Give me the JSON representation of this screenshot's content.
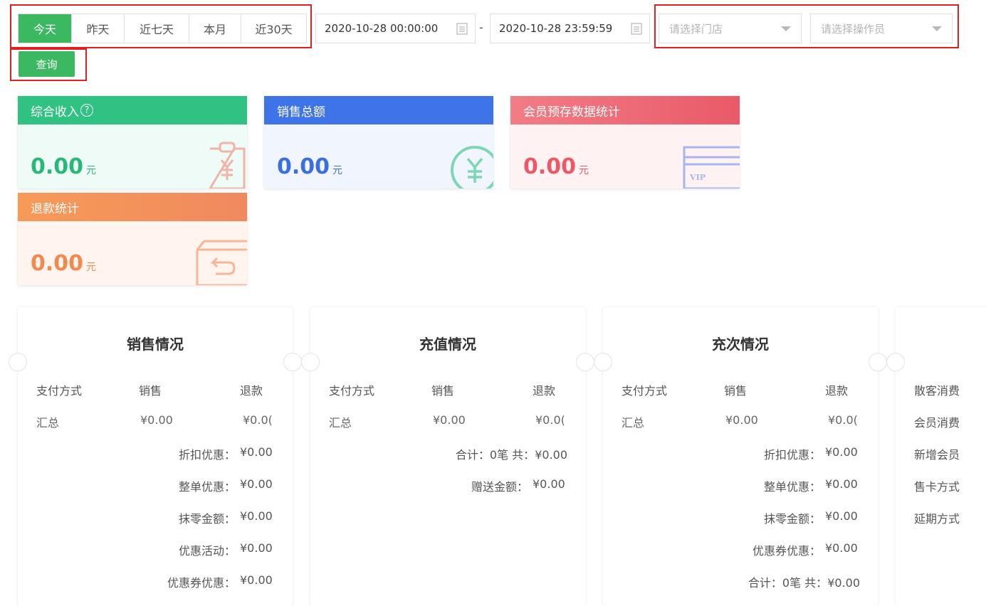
{
  "filters": {
    "ranges": [
      "今天",
      "昨天",
      "近七天",
      "本月",
      "近30天"
    ],
    "active_range": "今天",
    "start_date": "2020-10-28 00:00:00",
    "end_date": "2020-10-28 23:59:59",
    "date_sep": "-",
    "store_placeholder": "请选择门店",
    "operator_placeholder": "请选择操作员",
    "query_label": "查询"
  },
  "cards": [
    {
      "title": "综合收入",
      "help": "?",
      "value": "0.00",
      "unit": "元",
      "icon": "clipboard-yuan-icon",
      "head_color": "#30c283",
      "body_color": "#effbf6",
      "value_color": "#2ab87a"
    },
    {
      "title": "销售总额",
      "value": "0.00",
      "unit": "元",
      "icon": "yuan-circle-icon",
      "head_color": "#3f73e8",
      "body_color": "#f1f5fd",
      "value_color": "#3b6fe0"
    },
    {
      "title": "会员预存数据统计",
      "value": "0.00",
      "unit": "元",
      "icon": "vip-card-icon",
      "icon_text": "VIP",
      "head_color": "#ee6470",
      "body_color": "#fef2f3",
      "value_color": "#ec5866"
    },
    {
      "title": "退款统计",
      "value": "0.00",
      "unit": "元",
      "icon": "return-box-icon",
      "head_color": "#f5905a",
      "body_color": "#fff4ee",
      "value_color": "#f28a4f"
    }
  ],
  "panels": [
    {
      "title": "销售情况",
      "headers": [
        "支付方式",
        "销售",
        "退款"
      ],
      "rows": [
        [
          "汇总",
          "¥0.00",
          "¥0.0("
        ]
      ],
      "extras": [
        [
          "折扣优惠：",
          "¥0.00"
        ],
        [
          "整单优惠：",
          "¥0.00"
        ],
        [
          "抹零金额：",
          "¥0.00"
        ],
        [
          "优惠活动：",
          "¥0.00"
        ],
        [
          "优惠券优惠：",
          "¥0.00"
        ]
      ]
    },
    {
      "title": "充值情况",
      "headers": [
        "支付方式",
        "销售",
        "退款"
      ],
      "rows": [
        [
          "汇总",
          "¥0.00",
          "¥0.0("
        ]
      ],
      "extras": [
        [
          "合计：0笔 共：",
          "¥0.00"
        ],
        [
          "赠送金额：",
          "¥0.00"
        ]
      ]
    },
    {
      "title": "充次情况",
      "headers": [
        "支付方式",
        "销售",
        "退款"
      ],
      "rows": [
        [
          "汇总",
          "¥0.00",
          "¥0.0("
        ]
      ],
      "extras": [
        [
          "折扣优惠：",
          "¥0.00"
        ],
        [
          "整单优惠：",
          "¥0.00"
        ],
        [
          "抹零金额：",
          "¥0.00"
        ],
        [
          "优惠券优惠：",
          "¥0.00"
        ],
        [
          "合计：0笔 共：",
          "¥0.00"
        ]
      ]
    },
    {
      "title": "",
      "labels": [
        "散客消费",
        "会员消费",
        "新增会员",
        "售卡方式",
        "延期方式"
      ]
    }
  ]
}
